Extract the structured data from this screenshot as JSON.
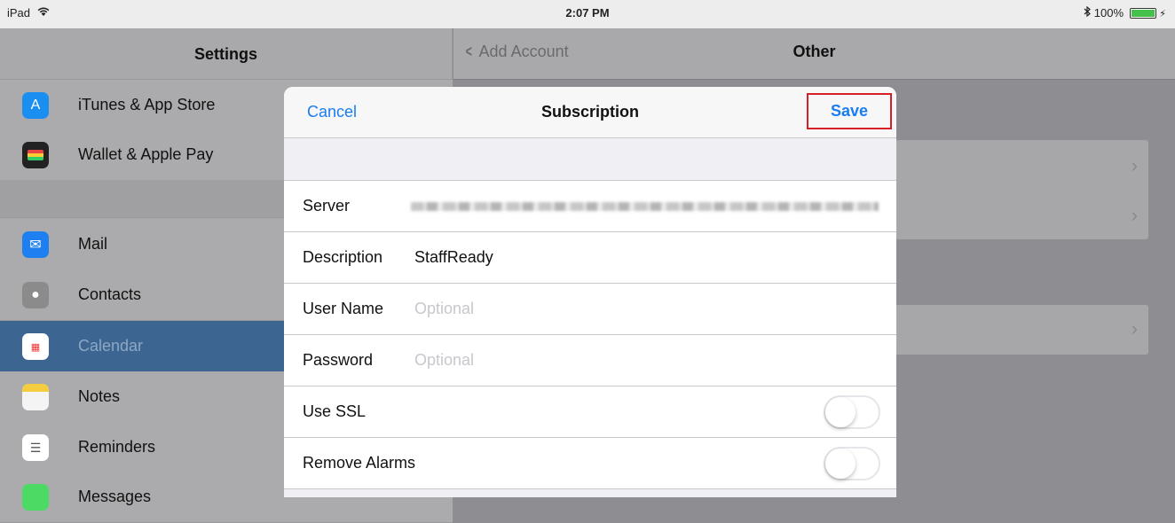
{
  "status_bar": {
    "device": "iPad",
    "time": "2:07 PM",
    "battery": "100%",
    "battery_level_percent": 100,
    "wifi_icon": "wifi-icon",
    "bluetooth_icon": "bluetooth-icon",
    "battery_fill_color": "#45c14b"
  },
  "master": {
    "title": "Settings",
    "items": [
      {
        "label": "iTunes & App Store",
        "icon": "app-store-icon",
        "color": "#1a8ff1"
      },
      {
        "label": "Wallet & Apple Pay",
        "icon": "wallet-icon",
        "color": "#222222"
      },
      {
        "label": "Mail",
        "icon": "mail-icon",
        "color": "#1e7ff0"
      },
      {
        "label": "Contacts",
        "icon": "contacts-icon",
        "color": "#8b8b8b"
      },
      {
        "label": "Calendar",
        "icon": "calendar-icon",
        "color": "#ffffff",
        "selected": true
      },
      {
        "label": "Notes",
        "icon": "notes-icon",
        "color": "#f5cd41"
      },
      {
        "label": "Reminders",
        "icon": "reminders-icon",
        "color": "#ffffff"
      },
      {
        "label": "Messages",
        "icon": "messages-icon",
        "color": "#4cd964"
      }
    ]
  },
  "detail": {
    "back_label": "Add Account",
    "title": "Other"
  },
  "modal": {
    "cancel_label": "Cancel",
    "title": "Subscription",
    "save_label": "Save",
    "fields": {
      "server_label": "Server",
      "description_label": "Description",
      "description_value": "StaffReady",
      "username_label": "User Name",
      "username_placeholder": "Optional",
      "password_label": "Password",
      "password_placeholder": "Optional",
      "use_ssl_label": "Use SSL",
      "use_ssl_on": false,
      "remove_alarms_label": "Remove Alarms",
      "remove_alarms_on": false
    },
    "accent_color": "#1a7cf2",
    "highlight_color": "#d81f26"
  }
}
